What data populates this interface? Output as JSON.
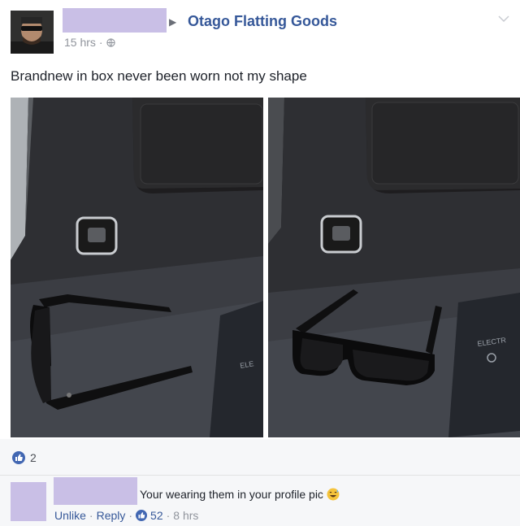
{
  "post": {
    "group_name": "Otago Flatting Goods",
    "timestamp": "15 hrs",
    "privacy_icon": "globe-icon",
    "text": "Brandnew in box never been worn not my shape"
  },
  "likes": {
    "count": "2",
    "icon": "like-icon"
  },
  "comment": {
    "text": "Your wearing them in your profile pic",
    "emoji": "grinning-sweat-emoji",
    "actions": {
      "unlike": "Unlike",
      "reply": "Reply",
      "like_count": "52",
      "time": "8 hrs"
    }
  },
  "colors": {
    "link": "#365899",
    "meta": "#90949c",
    "redaction": "#c9bfe6",
    "like_blue": "#4267b2"
  }
}
